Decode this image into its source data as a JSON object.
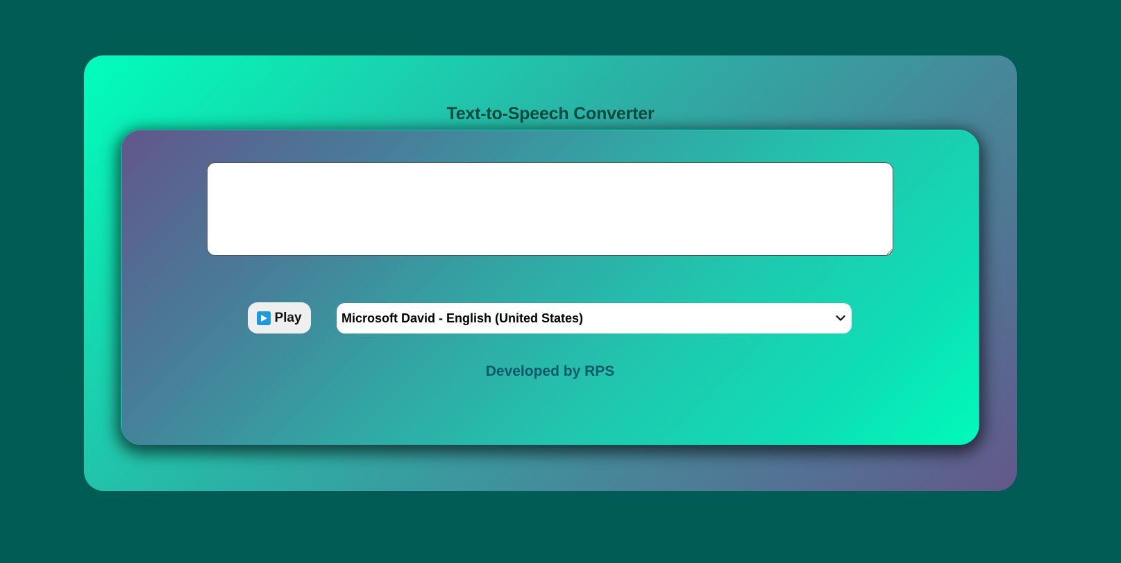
{
  "app": {
    "title": "Text-to-Speech Converter"
  },
  "text_input": {
    "value": "",
    "placeholder": ""
  },
  "controls": {
    "play_label": "Play",
    "play_icon": "play-icon",
    "voice_selected": "Microsoft David - English (United States)",
    "voice_dropdown_icon": "chevron-down-icon"
  },
  "footer": {
    "credit": "Developed by RPS"
  },
  "colors": {
    "page_background": "#005c55",
    "title_text": "#074a3f",
    "credit_text": "#0a5869",
    "play_icon_bg": "#1a9be0"
  }
}
